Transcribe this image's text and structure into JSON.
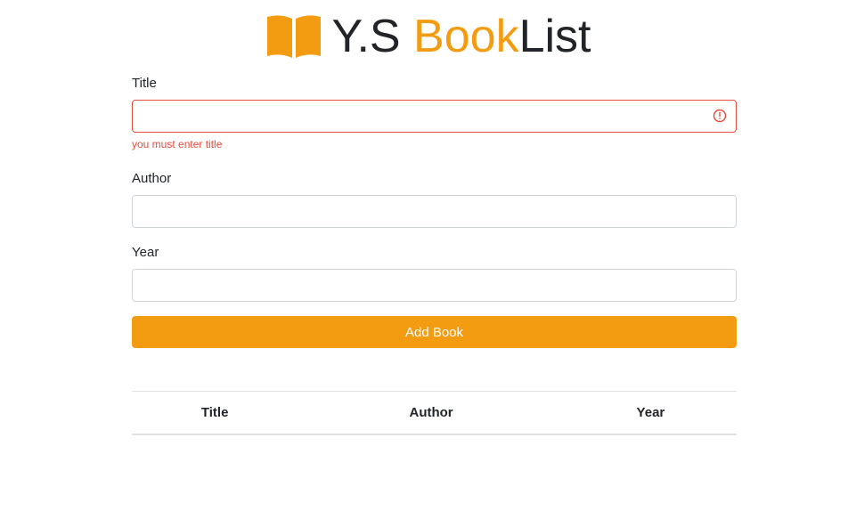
{
  "brand": {
    "prefix": "Y.S ",
    "book": "Book",
    "list": "List",
    "icon": "book-open-icon"
  },
  "form": {
    "title_label": "Title",
    "title_value": "",
    "title_error": "you must enter title",
    "author_label": "Author",
    "author_value": "",
    "year_label": "Year",
    "year_value": "",
    "submit_label": "Add Book"
  },
  "table": {
    "headers": [
      "Title",
      "Author",
      "Year"
    ],
    "rows": []
  },
  "colors": {
    "accent": "#f39c12",
    "error": "#e74c3c",
    "text": "#212529",
    "border": "#ced4da"
  }
}
